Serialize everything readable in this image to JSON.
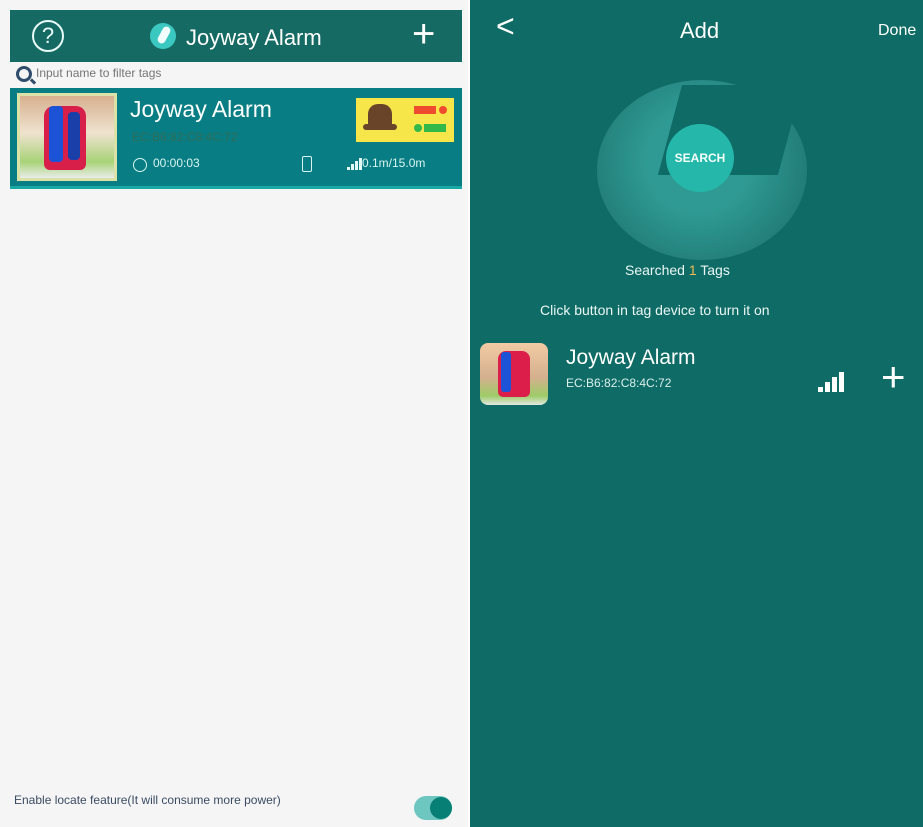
{
  "left_screen": {
    "header": {
      "help_icon": "?",
      "title": "Joyway Alarm",
      "add_icon": "+"
    },
    "search": {
      "placeholder": "Input name to filter tags"
    },
    "tag": {
      "name": "Joyway Alarm",
      "mac": "EC:B6:82:C8:4C:72",
      "timer": "00:00:03",
      "distance": "0.1m/15.0m"
    },
    "footer": {
      "locate_text": "Enable locate feature(It will consume more power)",
      "toggle_state": "on"
    }
  },
  "right_screen": {
    "header": {
      "back_icon": "<",
      "title": "Add",
      "done_label": "Done"
    },
    "search_button": "SEARCH",
    "searched": {
      "prefix": "Searched",
      "count": "1",
      "suffix": "Tags"
    },
    "hint": "Click button in tag device to turn it on",
    "result": {
      "name": "Joyway Alarm",
      "mac": "EC:B6:82:C8:4C:72",
      "add_icon": "+"
    }
  },
  "colors": {
    "primary_teal": "#0f6b66",
    "header_teal": "#166a64",
    "accent": "#24b7aa",
    "warning_badge": "#f6e64a"
  }
}
